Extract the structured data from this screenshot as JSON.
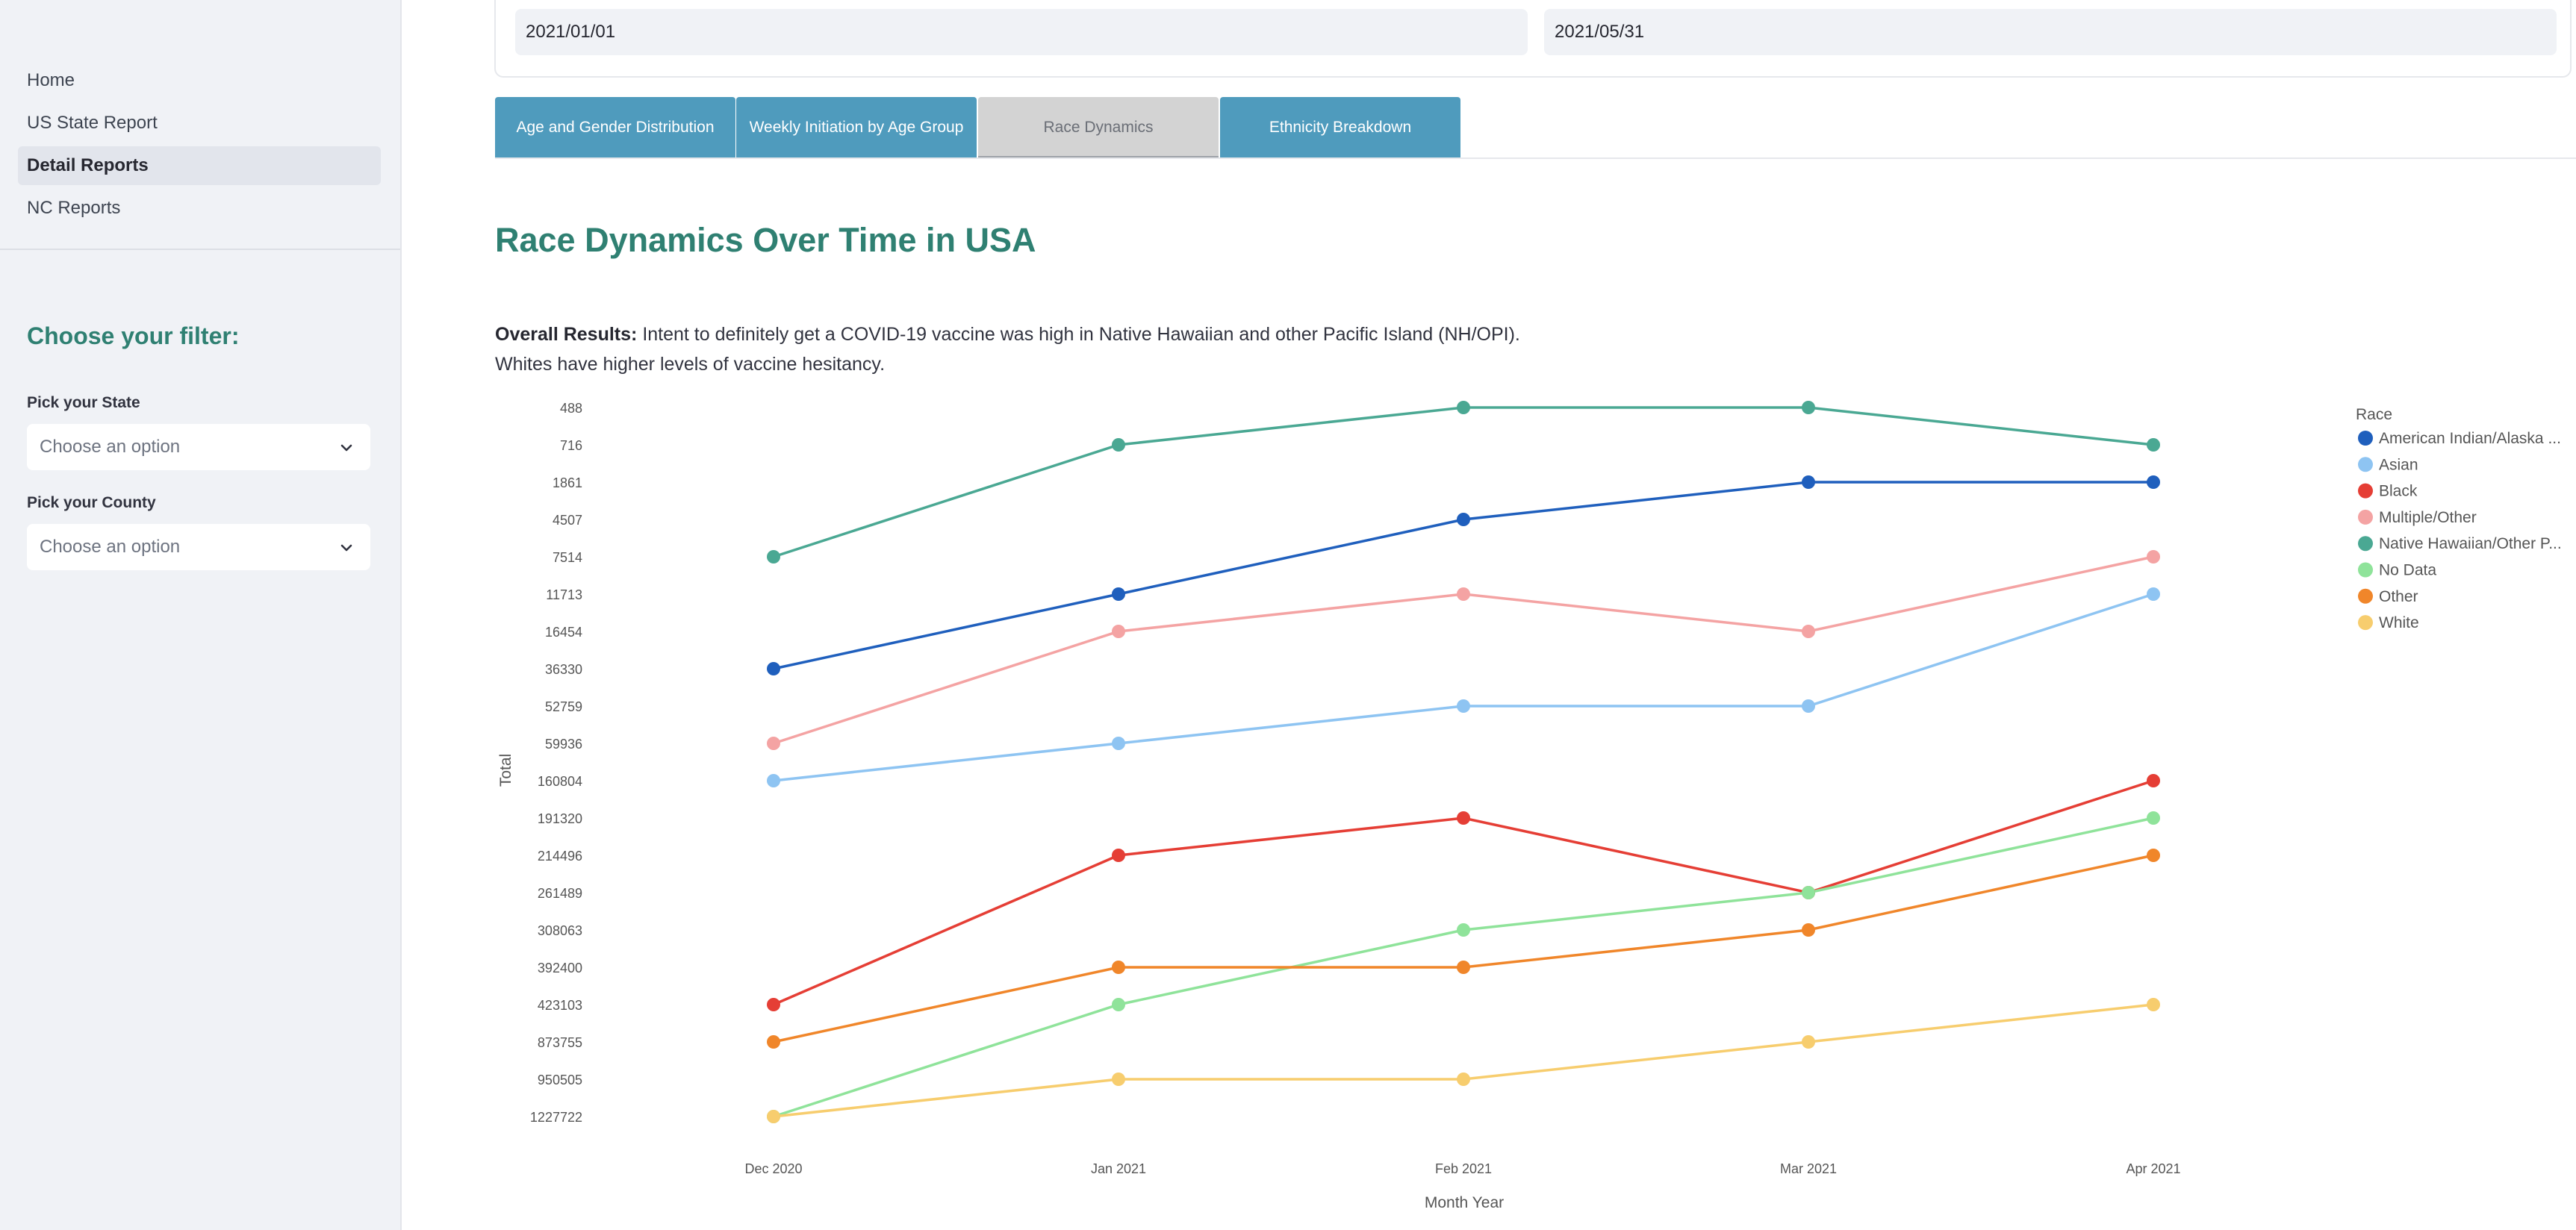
{
  "sidebar": {
    "nav": [
      {
        "label": "Home"
      },
      {
        "label": "US State Report"
      },
      {
        "label": "Detail Reports"
      },
      {
        "label": "NC Reports"
      }
    ],
    "filter_title": "Choose your filter:",
    "state": {
      "label": "Pick your State",
      "value": "Choose an option"
    },
    "county": {
      "label": "Pick your County",
      "value": "Choose an option"
    }
  },
  "dates": {
    "start": "2021/01/01",
    "end": "2021/05/31"
  },
  "tabs": [
    {
      "label": "Age and Gender Distribution"
    },
    {
      "label": "Weekly Initiation by Age Group"
    },
    {
      "label": "Race Dynamics"
    },
    {
      "label": "Ethnicity Breakdown"
    }
  ],
  "active_tab": "Race Dynamics",
  "page_title": "Race Dynamics Over Time in USA",
  "summary": {
    "bold": "Overall Results:",
    "text": "Intent to definitely get a COVID-19 vaccine was high in Native Hawaiian and other Pacific Island (NH/OPI).",
    "line2": "Whites have higher levels of vaccine hesitancy."
  },
  "chart_data": {
    "type": "line",
    "xlabel": "Month Year",
    "ylabel": "Total",
    "categories": [
      "Dec 2020",
      "Jan 2021",
      "Feb 2021",
      "Mar 2021",
      "Apr 2021"
    ],
    "y_ticks": [
      "488",
      "716",
      "1861",
      "4507",
      "7514",
      "11713",
      "16454",
      "36330",
      "52759",
      "59936",
      "160804",
      "191320",
      "214496",
      "261489",
      "308063",
      "392400",
      "423103",
      "873755",
      "950505",
      "1227722"
    ],
    "y_scale": "categorical, ascending downward",
    "grid": false,
    "legend_title": "Race",
    "legend_position": "right",
    "series": [
      {
        "name": "American Indian/Alaska ...",
        "color": "#1f5fbd",
        "values": [
          "36330",
          "11713",
          "4507",
          "1861",
          "1861"
        ]
      },
      {
        "name": "Asian",
        "color": "#8ec4f2",
        "values": [
          "160804",
          "59936",
          "52759",
          "52759",
          "11713"
        ]
      },
      {
        "name": "Black",
        "color": "#e53e35",
        "values": [
          "423103",
          "214496",
          "191320",
          "261489",
          "160804"
        ]
      },
      {
        "name": "Multiple/Other",
        "color": "#f4a3a3",
        "values": [
          "59936",
          "16454",
          "11713",
          "16454",
          "7514"
        ]
      },
      {
        "name": "Native Hawaiian/Other P...",
        "color": "#4aa893",
        "values": [
          "7514",
          "716",
          "488",
          "488",
          "716"
        ]
      },
      {
        "name": "No Data",
        "color": "#8fe39a",
        "values": [
          "1227722",
          "423103",
          "308063",
          "261489",
          "191320"
        ]
      },
      {
        "name": "Other",
        "color": "#f0862a",
        "values": [
          "873755",
          "392400",
          "392400",
          "308063",
          "214496"
        ]
      },
      {
        "name": "White",
        "color": "#f7cd6e",
        "values": [
          "1227722",
          "950505",
          "950505",
          "873755",
          "423103"
        ]
      }
    ]
  }
}
